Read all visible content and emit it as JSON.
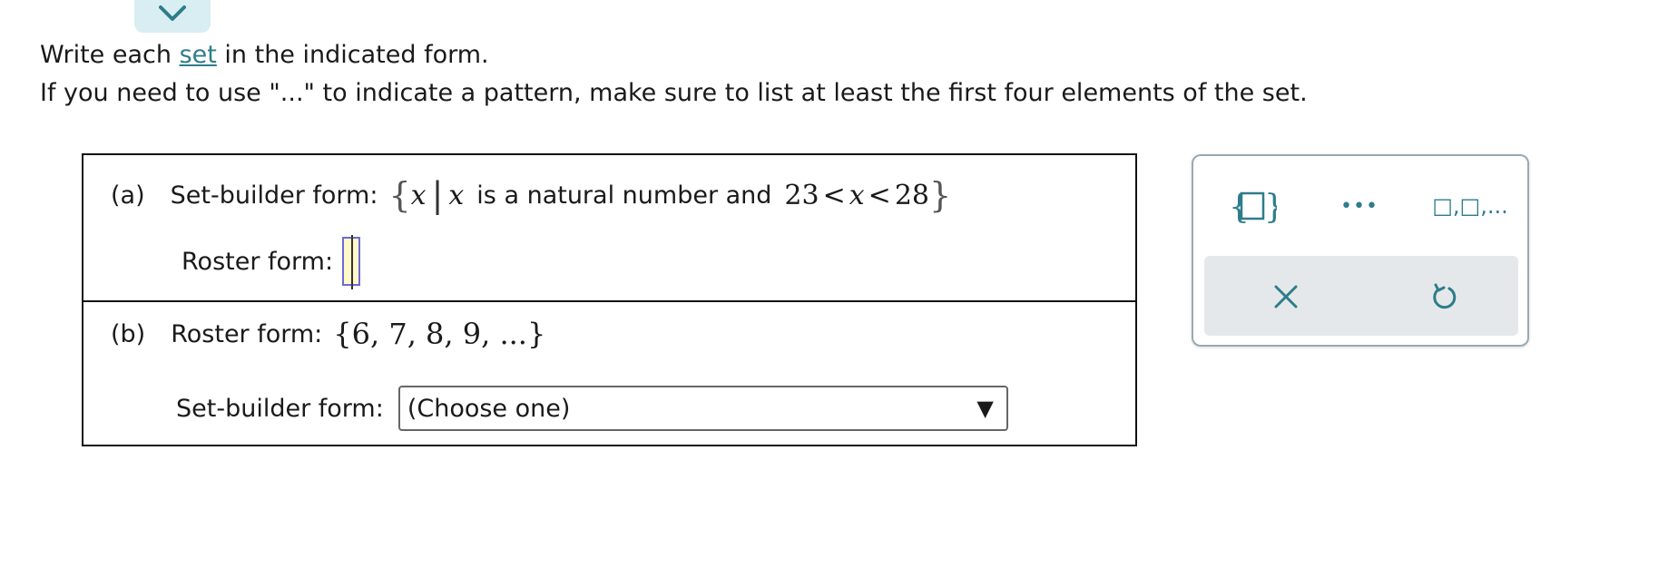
{
  "instructions": {
    "line1_before": "Write each ",
    "line1_link": "set",
    "line1_after": " in the indicated form.",
    "line2": "If you need to use \"...\" to indicate a pattern, make sure to list at least the first four elements of the set."
  },
  "part_a": {
    "label": "(a)",
    "setbuilder_label": "Set-builder form:",
    "open_brace": "{",
    "var": "x",
    "divider": "|",
    "var2": "x",
    "condition_text": "is a natural number and",
    "bound_low": "23",
    "lt1": "<",
    "var3": "x",
    "lt2": "<",
    "bound_high": "28",
    "close_brace": "}",
    "roster_label": "Roster form:",
    "roster_value": ""
  },
  "part_b": {
    "label": "(b)",
    "roster_label": "Roster form:",
    "roster_set": "{6, 7, 8, 9, ...}",
    "setbuilder_label": "Set-builder form:",
    "dropdown_value": "(Choose one)",
    "dropdown_arrow": "▼"
  },
  "palette": {
    "set_braces_icon": "set-braces-icon",
    "ellipsis_label": "•••",
    "list_template_label": "□,□,...",
    "clear_icon": "close-icon",
    "undo_icon": "undo-icon"
  },
  "colors": {
    "accent": "#2e7d8a",
    "tab_bg": "#d9eef2",
    "answer_box_bg": "#fff8c8",
    "answer_box_border": "#6b6bd6",
    "palette_action_bg": "#e5e8ea"
  }
}
